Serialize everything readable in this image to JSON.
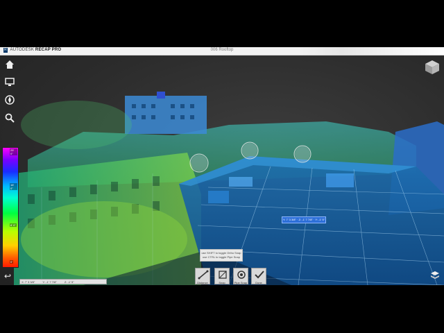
{
  "titlebar": {
    "brand_prefix": "AUTODESK",
    "brand_name": "RECAP PRO",
    "logo_letter": "R",
    "document_title": "006 Rooftop"
  },
  "left_toolbar": {
    "icons": [
      {
        "name": "home-icon",
        "glyph": "⌂"
      },
      {
        "name": "monitor-icon",
        "glyph": "▭"
      },
      {
        "name": "navigate-icon",
        "glyph": "⊕"
      },
      {
        "name": "search-icon",
        "glyph": "⚲"
      }
    ],
    "back_glyph": "↩"
  },
  "colorbar": {
    "labels": [
      "25' 0\"",
      "16' 0\"",
      "8' 0\"",
      "0'"
    ]
  },
  "hint": {
    "line1": "use SHIFT to toggle Ortho Snap",
    "line2": "use CTRL to toggle Pipe Snap"
  },
  "measure_tag": "Y: 7' 3 3/8\"  ·  Z: -1' 7 7/8\"  ·  Y: -1' 5\"",
  "bottom_tools": [
    {
      "name": "distance-button",
      "icon": "distance-icon",
      "label": "Distance"
    },
    {
      "name": "snap-button",
      "icon": "snap-icon",
      "label": "Snap"
    },
    {
      "name": "pipe-snap-button",
      "icon": "pipe-snap-icon",
      "label": "Pipe Snap"
    },
    {
      "name": "done-button",
      "icon": "checkmark-icon",
      "label": "Done"
    }
  ],
  "coords": {
    "x": "X: 7' 3 3/8\"",
    "y": "Y: -1' 7 7/8\"",
    "z": "Z: -1' 5\""
  },
  "colors": {
    "viewport_bg": "#2b2b2b",
    "titlebar_bg": "#f2f2f2",
    "measure_accent": "#2d6fd8"
  }
}
